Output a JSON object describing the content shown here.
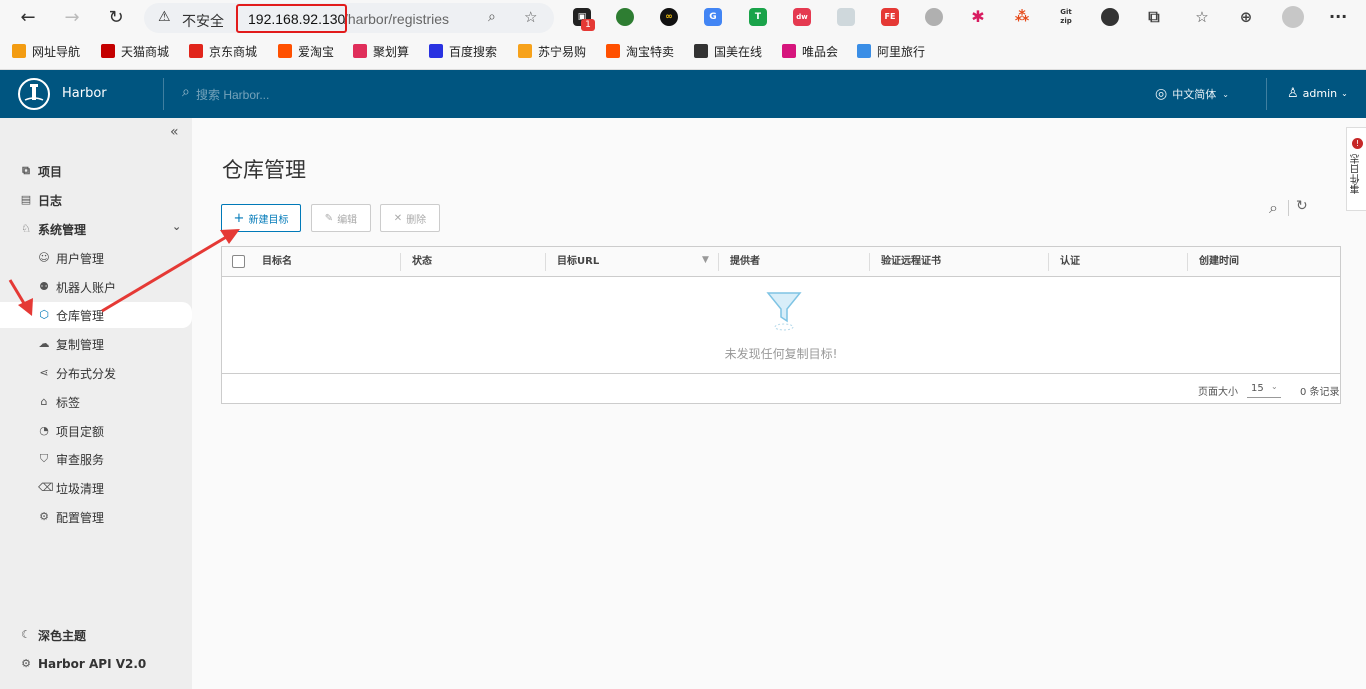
{
  "browser": {
    "security_label": "不安全",
    "url_host": "192.168.92.130",
    "url_path": "/harbor/registries",
    "notification_count": "1",
    "bookmarks": [
      {
        "label": "网址导航",
        "icon": "bookmark-icon",
        "color": "#f39c12"
      },
      {
        "label": "天猫商城",
        "icon": "tmall-icon",
        "color": "#c40000"
      },
      {
        "label": "京东商城",
        "icon": "jd-icon",
        "color": "#e1251b"
      },
      {
        "label": "爱淘宝",
        "icon": "taobao-icon",
        "color": "#ff5000"
      },
      {
        "label": "聚划算",
        "icon": "juhuasuan-icon",
        "color": "#e02e5a"
      },
      {
        "label": "百度搜索",
        "icon": "baidu-icon",
        "color": "#2932e1"
      },
      {
        "label": "苏宁易购",
        "icon": "suning-icon",
        "color": "#f7a21b"
      },
      {
        "label": "淘宝特卖",
        "icon": "taobao-icon",
        "color": "#ff5000"
      },
      {
        "label": "国美在线",
        "icon": "gome-icon",
        "color": "#333333"
      },
      {
        "label": "唯品会",
        "icon": "vip-icon",
        "color": "#d6157d"
      },
      {
        "label": "阿里旅行",
        "icon": "alitrip-icon",
        "color": "#3a8ee6"
      }
    ]
  },
  "header": {
    "brand": "Harbor",
    "search_placeholder": "搜索 Harbor...",
    "language": "中文简体",
    "user": "admin",
    "bg_color": "#005580"
  },
  "sidebar": {
    "collapse_icon": "double-chevron-left-icon",
    "items": [
      {
        "label": "项目",
        "icon": "projects-icon",
        "level": "top"
      },
      {
        "label": "日志",
        "icon": "logs-icon",
        "level": "top"
      },
      {
        "label": "系统管理",
        "icon": "admin-icon",
        "level": "top",
        "expanded": true
      },
      {
        "label": "用户管理",
        "icon": "users-icon",
        "level": "sub"
      },
      {
        "label": "机器人账户",
        "icon": "robot-icon",
        "level": "sub"
      },
      {
        "label": "仓库管理",
        "icon": "cube-icon",
        "level": "sub",
        "active": true
      },
      {
        "label": "复制管理",
        "icon": "replication-icon",
        "level": "sub"
      },
      {
        "label": "分布式分发",
        "icon": "share-icon",
        "level": "sub"
      },
      {
        "label": "标签",
        "icon": "tag-icon",
        "level": "sub"
      },
      {
        "label": "项目定额",
        "icon": "quota-icon",
        "level": "sub"
      },
      {
        "label": "审查服务",
        "icon": "shield-icon",
        "level": "sub"
      },
      {
        "label": "垃圾清理",
        "icon": "trash-icon",
        "level": "sub"
      },
      {
        "label": "配置管理",
        "icon": "gear-icon",
        "level": "sub"
      }
    ],
    "footer": {
      "theme": "深色主题",
      "api": "Harbor API V2.0"
    }
  },
  "main": {
    "title": "仓库管理",
    "toolbar": {
      "new": "新建目标",
      "edit": "编辑",
      "delete": "删除"
    },
    "table": {
      "columns": [
        "目标名",
        "状态",
        "目标URL",
        "提供者",
        "验证远程证书",
        "认证",
        "创建时间"
      ],
      "empty_message": "未发现任何复制目标!",
      "page_size_label": "页面大小",
      "page_size": "15",
      "total": "0 条记录"
    }
  },
  "side_tab": {
    "label": "事件日志",
    "badge": "!"
  }
}
